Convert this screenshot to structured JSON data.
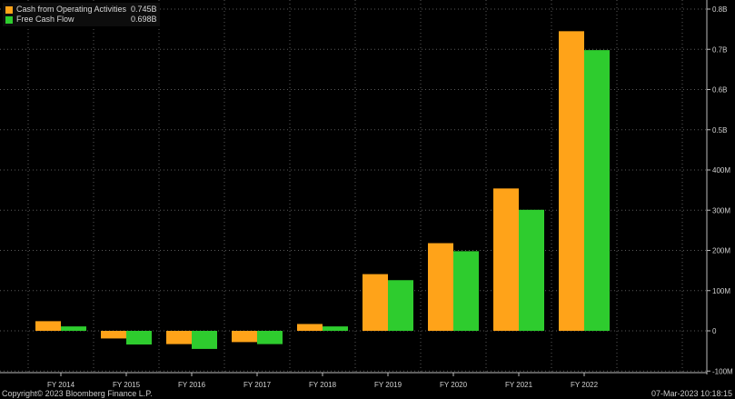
{
  "legend": [
    {
      "name": "Cash from Operating Activities",
      "value": "0.745B",
      "color": "#FFA319"
    },
    {
      "name": "Free Cash Flow",
      "value": "0.698B",
      "color": "#2ECC2E"
    }
  ],
  "footer": {
    "copyright": "Copyright© 2023 Bloomberg Finance L.P.",
    "timestamp": "07-Mar-2023 10:18:15"
  },
  "chart_data": {
    "type": "bar",
    "categories": [
      "FY 2014",
      "FY 2015",
      "FY 2016",
      "FY 2017",
      "FY 2018",
      "FY 2019",
      "FY 2020",
      "FY 2021",
      "FY 2022"
    ],
    "series": [
      {
        "name": "Cash from Operating Activities",
        "color": "#FFA319",
        "values": [
          24,
          -19,
          -33,
          -28,
          17,
          141,
          218,
          354,
          745
        ]
      },
      {
        "name": "Free Cash Flow",
        "color": "#2ECC2E",
        "values": [
          11,
          -34,
          -45,
          -33,
          11,
          126,
          198,
          301,
          698
        ]
      }
    ],
    "units": "millions",
    "ylim": [
      -100,
      850
    ],
    "yticks": [
      {
        "value": -100,
        "label": "-100M"
      },
      {
        "value": 0,
        "label": "0"
      },
      {
        "value": 100,
        "label": "100M"
      },
      {
        "value": 200,
        "label": "200M"
      },
      {
        "value": 300,
        "label": "300M"
      },
      {
        "value": 400,
        "label": "400M"
      },
      {
        "value": 500,
        "label": "0.5B"
      },
      {
        "value": 600,
        "label": "0.6B"
      },
      {
        "value": 700,
        "label": "0.7B"
      },
      {
        "value": 800,
        "label": "0.8B"
      }
    ],
    "axis_side": "right",
    "grid": true,
    "legend_position": "top-left"
  }
}
